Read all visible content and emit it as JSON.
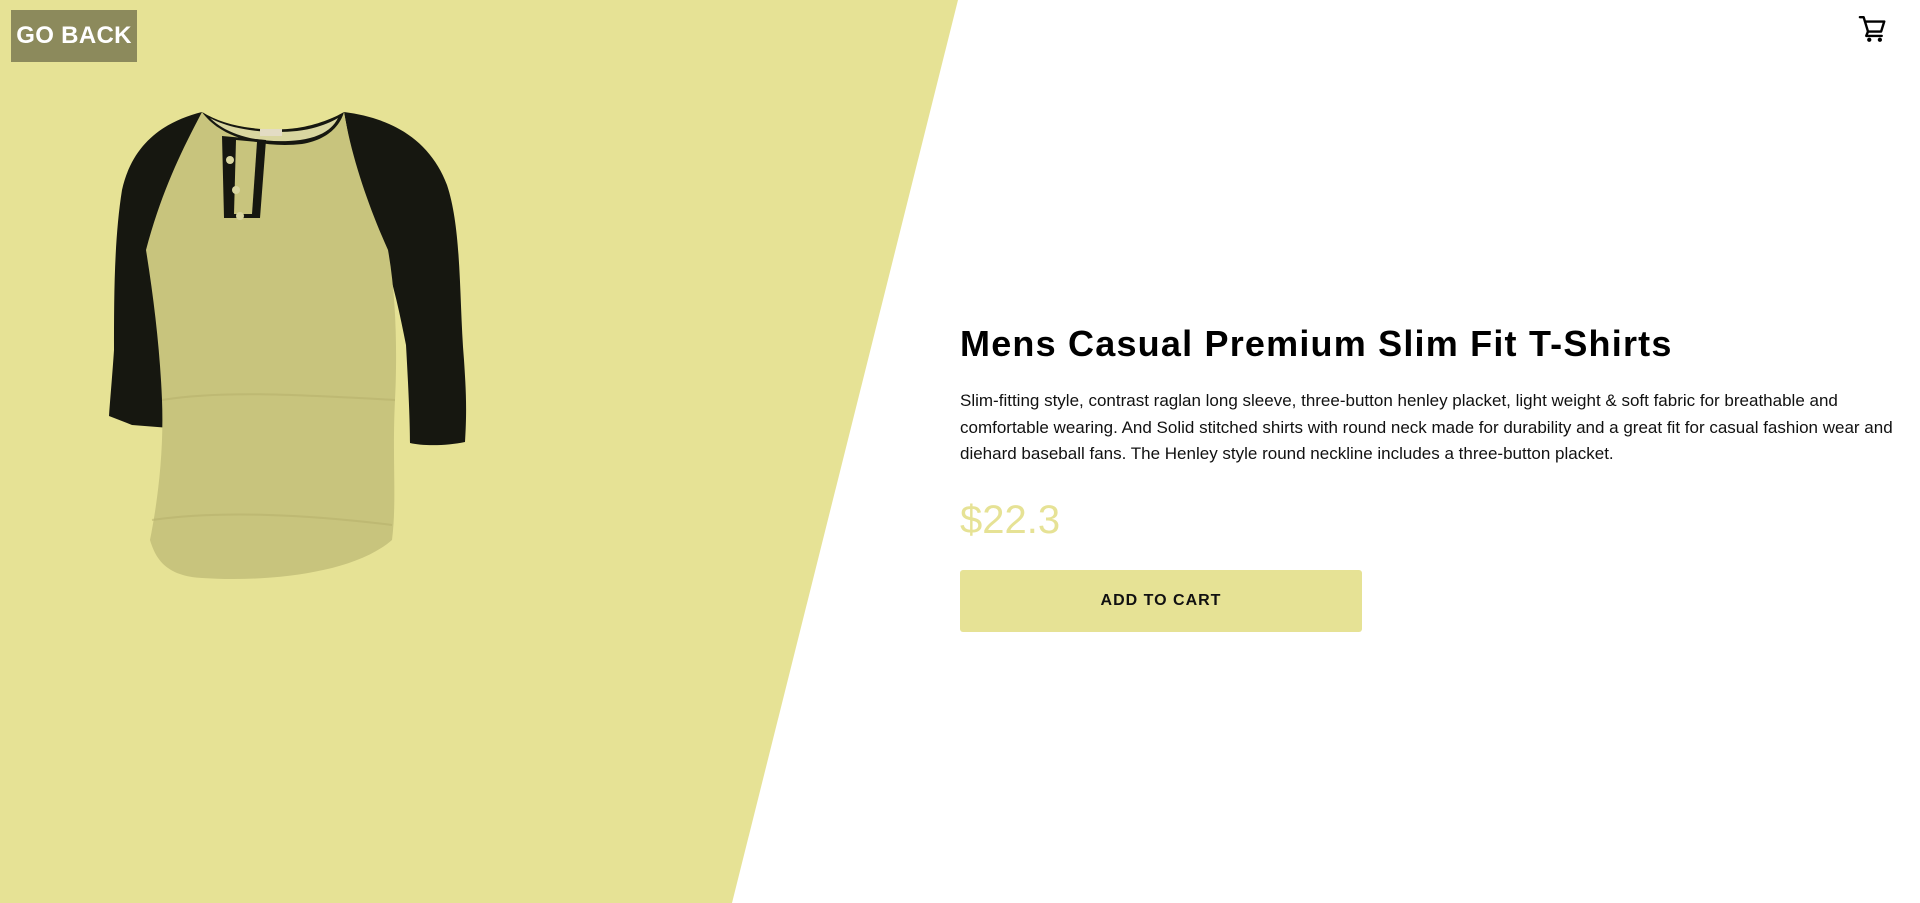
{
  "nav": {
    "back_label": "GO BACK",
    "cart_icon": "shopping-cart-icon"
  },
  "product": {
    "title": "Mens Casual Premium Slim Fit T-Shirts",
    "description": "Slim-fitting style, contrast raglan long sleeve, three-button henley placket, light weight & soft fabric for breathable and comfortable wearing. And Solid stitched shirts with round neck made for durability and a great fit for casual fashion wear and diehard baseball fans. The Henley style round neckline includes a three-button placket.",
    "price": "$22.3",
    "add_to_cart_label": "ADD TO CART",
    "image_alt": "raglan henley t-shirt"
  },
  "colors": {
    "accent": "#e6e295",
    "back_button_bg": "#8c8a5c",
    "shirt_body": "#c8c47d",
    "shirt_sleeves": "#161710"
  }
}
